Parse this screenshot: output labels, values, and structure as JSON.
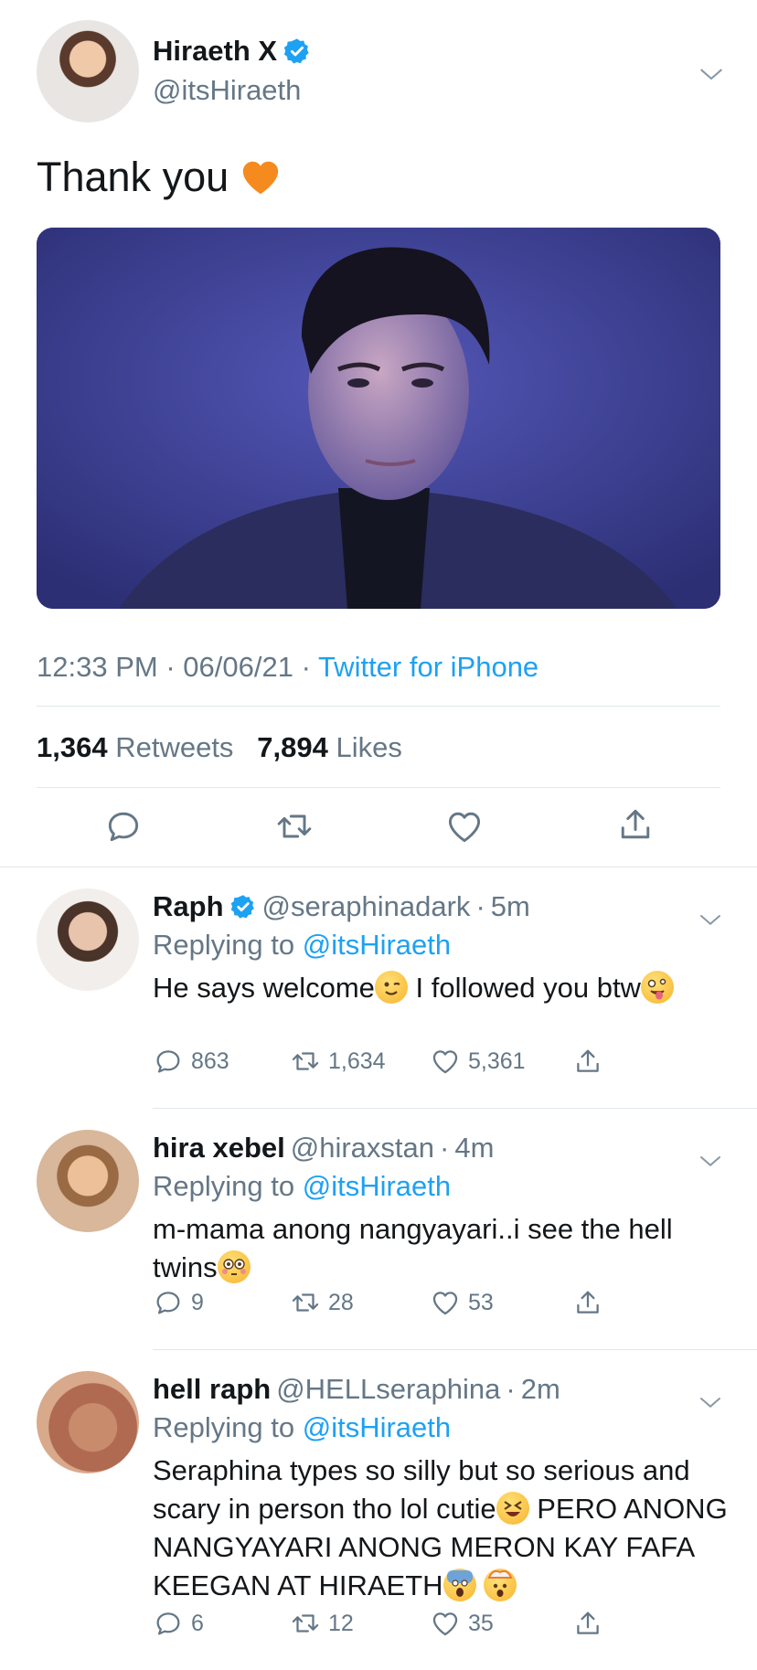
{
  "tweet": {
    "name": "Hiraeth X",
    "handle": "@itsHiraeth",
    "text": "Thank you",
    "time": "12:33 PM",
    "date": "06/06/21",
    "source": "Twitter for iPhone",
    "retweets": "1,364",
    "retweets_label": "Retweets",
    "likes": "7,894",
    "likes_label": "Likes",
    "icons": [
      "reply-icon",
      "retweet-icon",
      "like-icon",
      "share-icon"
    ],
    "colors": {
      "accent": "#1da1f2",
      "verified": "#1da1f2",
      "heart": "#f58a1f"
    }
  },
  "replies": [
    {
      "name": "Raph",
      "verified": true,
      "handle": "@seraphinadark",
      "age": "5m",
      "replying_prefix": "Replying to",
      "replying_to": "@itsHiraeth",
      "text_a": "He says welcome",
      "text_b": " I followed you btw",
      "replies": "863",
      "retweets": "1,634",
      "likes": "5,361"
    },
    {
      "name": "hira xebel",
      "verified": false,
      "handle": "@hiraxstan",
      "age": "4m",
      "replying_prefix": "Replying to",
      "replying_to": "@itsHiraeth",
      "text_a": "m-mama anong nangyayari..i see the hell twins",
      "replies": "9",
      "retweets": "28",
      "likes": "53"
    },
    {
      "name": "hell raph",
      "verified": false,
      "handle": "@HELLseraphina",
      "age": "2m",
      "replying_prefix": "Replying to",
      "replying_to": "@itsHiraeth",
      "text_a": "Seraphina types so silly but so serious and scary in person tho lol cutie",
      "text_b": "  PERO ANONG NANGYAYARI ANONG MERON KAY FAFA KEEGAN AT HIRAETH",
      "replies": "6",
      "retweets": "12",
      "likes": "35"
    }
  ]
}
